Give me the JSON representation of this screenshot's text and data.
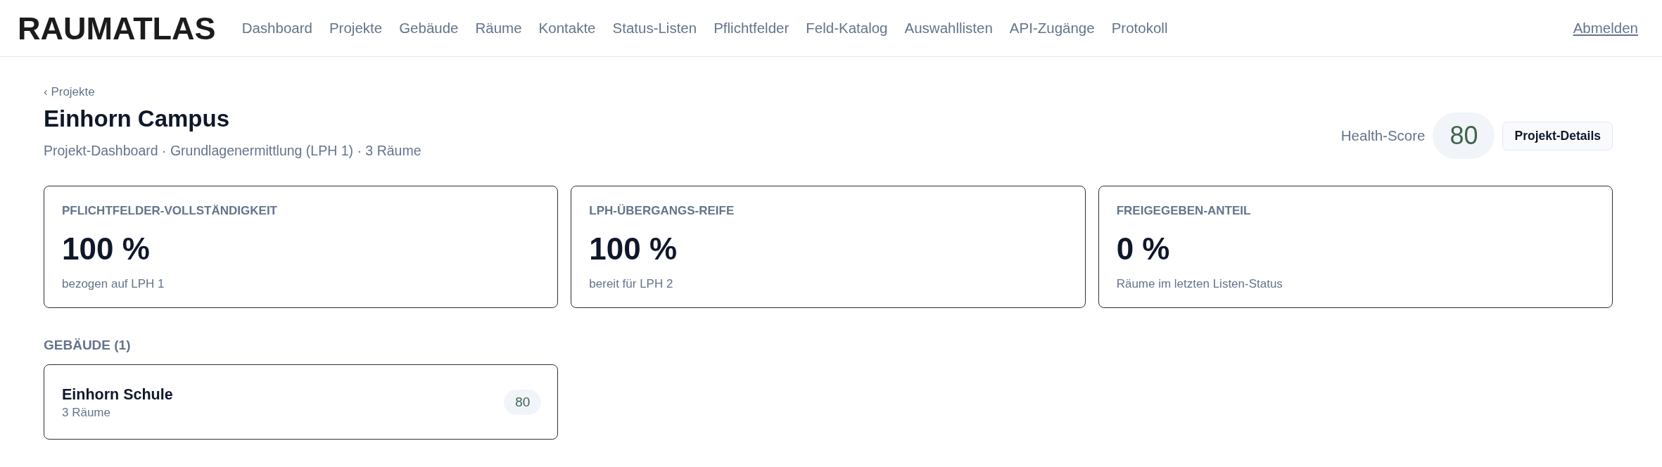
{
  "header": {
    "logo": "RAUMATLAS",
    "nav": [
      {
        "label": "Dashboard",
        "selected": false
      },
      {
        "label": "Projekte",
        "selected": false
      },
      {
        "label": "Gebäude",
        "selected": false
      },
      {
        "label": "Räume",
        "selected": false
      },
      {
        "label": "Kontakte",
        "selected": false
      },
      {
        "label": "Status-Listen",
        "selected": false
      },
      {
        "label": "Pflichtfelder",
        "selected": false
      },
      {
        "label": "Feld-Katalog",
        "selected": false
      },
      {
        "label": "Auswahllisten",
        "selected": false
      },
      {
        "label": "API-Zugänge",
        "selected": false
      },
      {
        "label": "Protokoll",
        "selected": false
      }
    ],
    "logout": "Abmelden"
  },
  "page": {
    "breadcrumb": "‹ Projekte",
    "title": "Einhorn Campus",
    "subtitle": "Projekt-Dashboard · Grundlagenermittlung (LPH 1) · 3 Räume",
    "health_score": {
      "label": "Health-Score",
      "value": "80"
    },
    "details_button": "Projekt-Details"
  },
  "metrics": [
    {
      "label": "PFLICHTFELDER-VOLLSTÄNDIGKEIT",
      "value": "100 %",
      "note": "bezogen auf LPH 1"
    },
    {
      "label": "LPH-ÜBERGANGS-REIFE",
      "value": "100 %",
      "note": "bereit für LPH 2"
    },
    {
      "label": "FREIGEGEBEN-ANTEIL",
      "value": "0 %",
      "note": "Räume im letzten Listen-Status"
    }
  ],
  "buildings": {
    "heading": "GEBÄUDE (1)",
    "items": [
      {
        "name": "Einhorn Schule",
        "rooms": "3 Räume",
        "score": "80"
      }
    ]
  }
}
